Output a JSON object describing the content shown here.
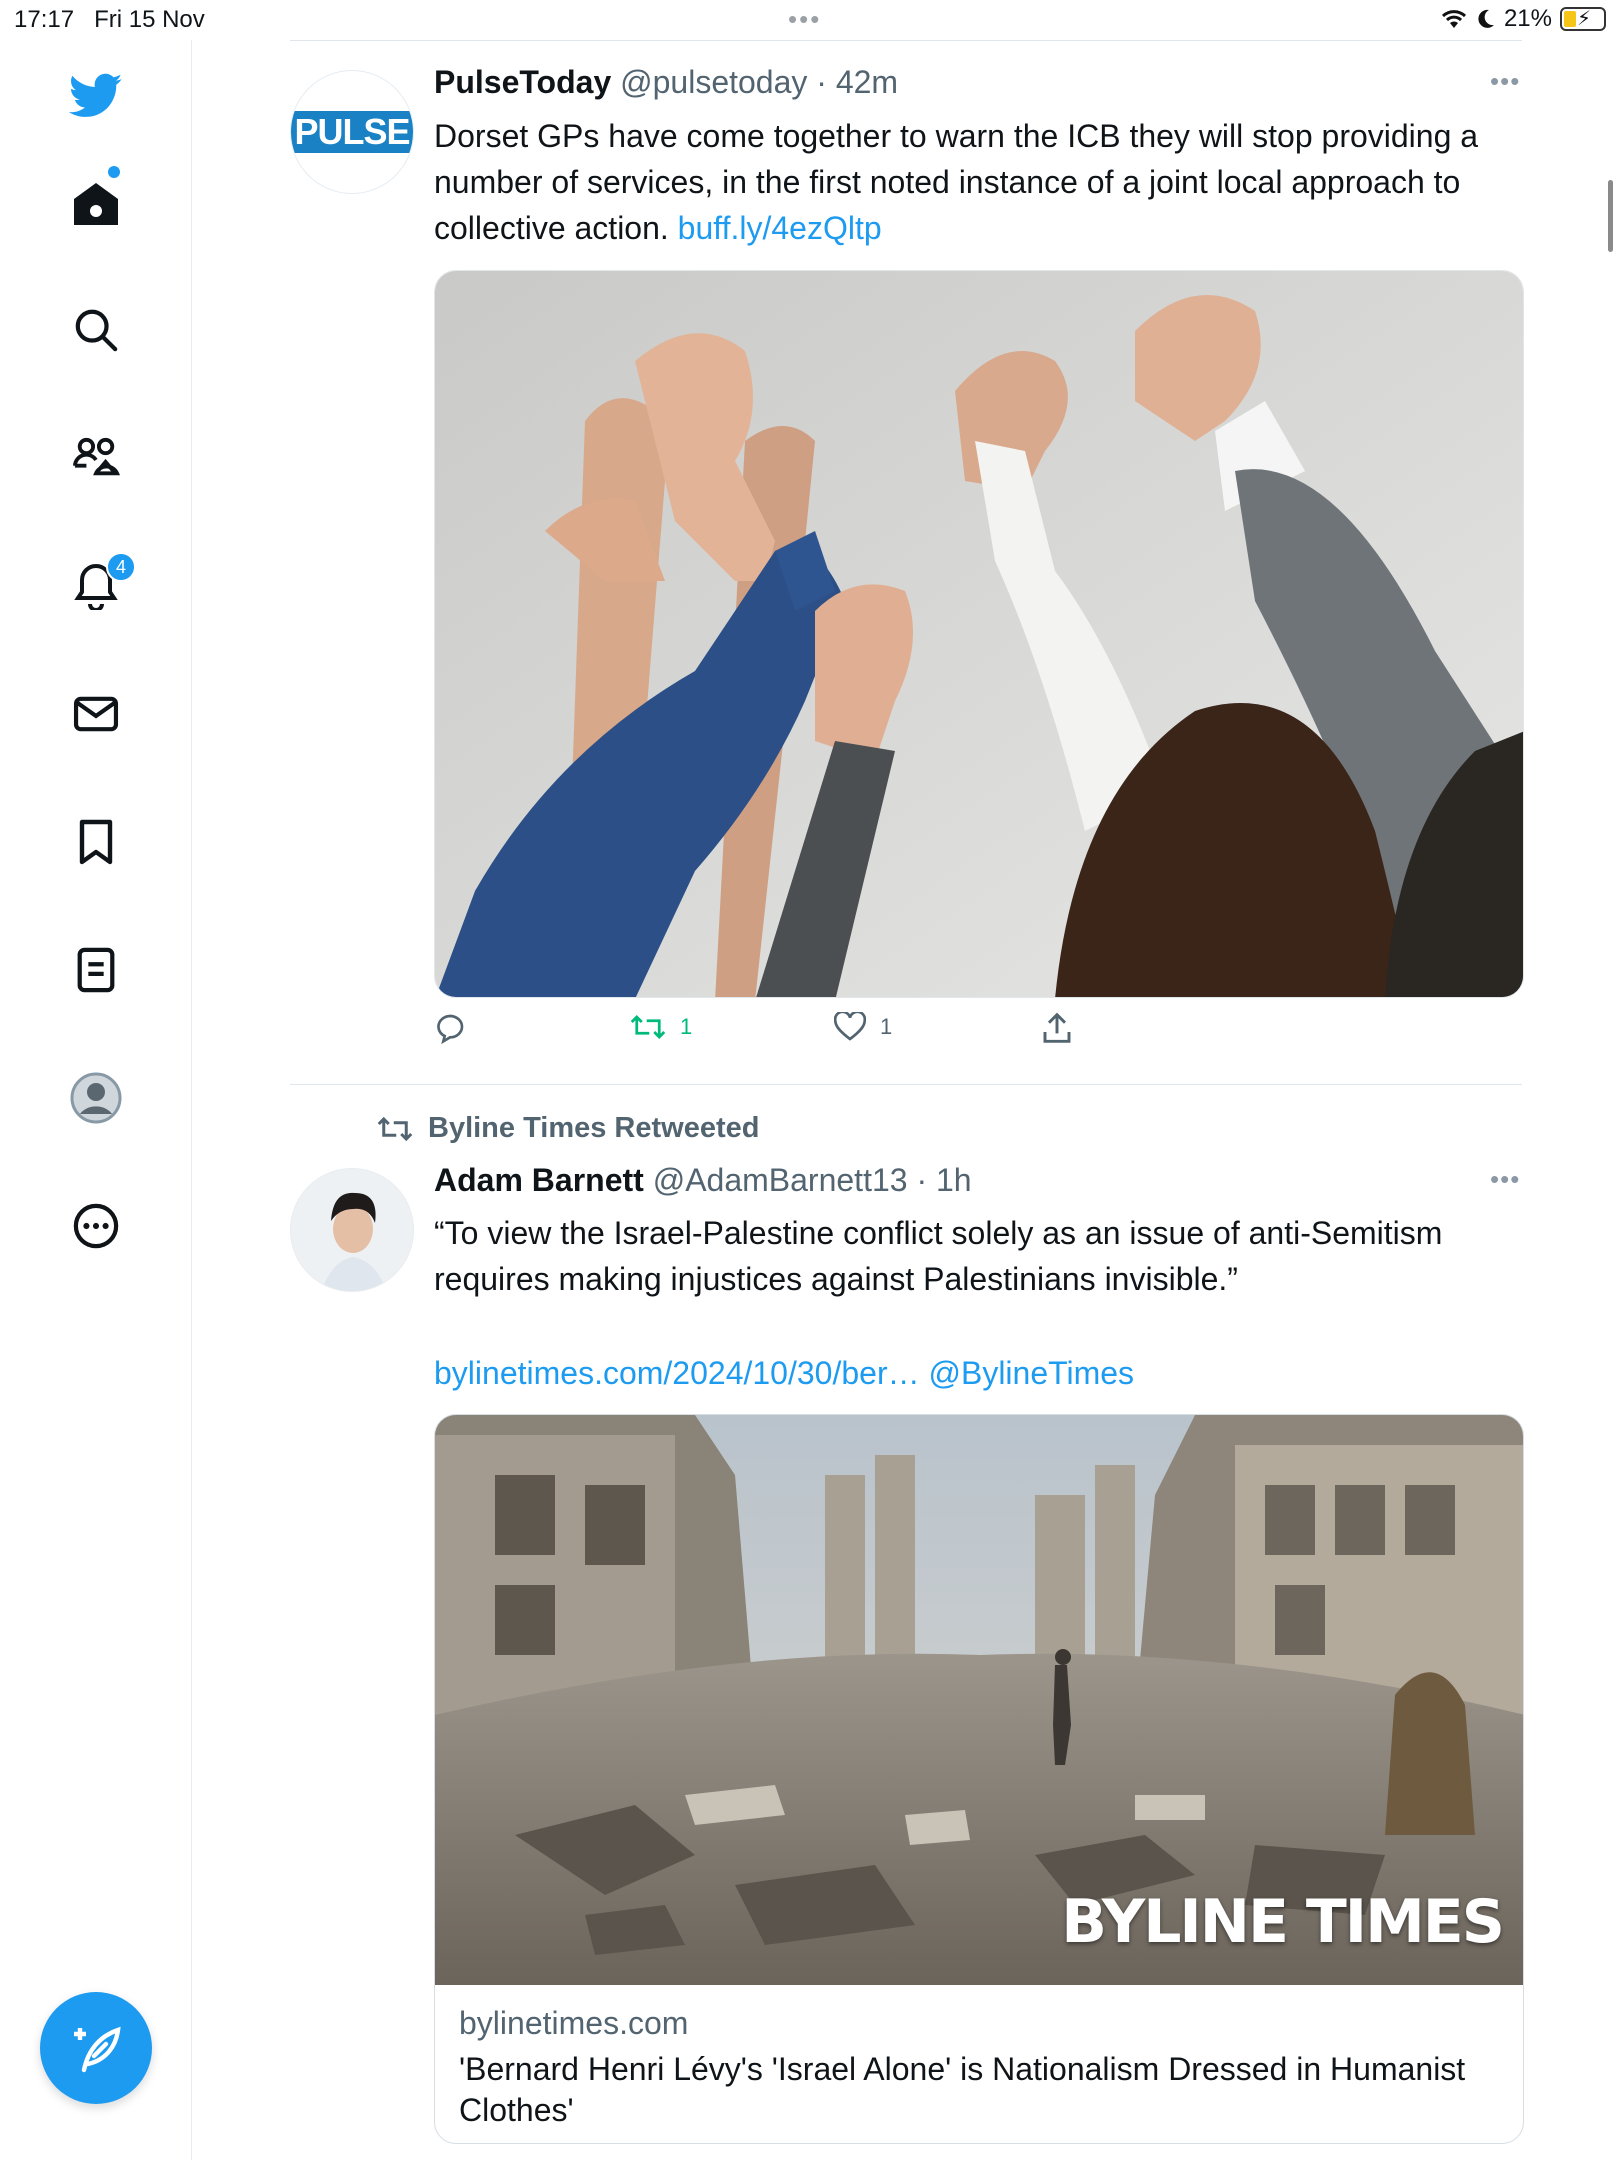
{
  "status_bar": {
    "time": "17:17",
    "date": "Fri 15 Nov",
    "battery": "21%",
    "dots": "•••"
  },
  "sidebar": {
    "items": [
      {
        "icon": "twitter-bird-icon"
      },
      {
        "icon": "home-icon"
      },
      {
        "icon": "search-icon"
      },
      {
        "icon": "communities-icon"
      },
      {
        "icon": "notifications-icon",
        "badge": "4"
      },
      {
        "icon": "messages-icon"
      },
      {
        "icon": "bookmarks-icon"
      },
      {
        "icon": "lists-icon"
      },
      {
        "icon": "profile-icon"
      },
      {
        "icon": "more-icon"
      }
    ],
    "compose_icon": "compose-feather-icon",
    "accent": "#1d9bf0"
  },
  "tweets": [
    {
      "name": "PulseToday",
      "handle": "@pulsetoday",
      "time": "42m",
      "avatar_text": "PULSE",
      "text": "Dorset GPs have come together to warn the ICB they will stop providing a number of services, in the first noted instance of a joint local approach to collective action.",
      "link": "buff.ly/4ezQltp",
      "image_alt": "Raised fists photo",
      "actions": {
        "reply": "",
        "retweet": "1",
        "like": "1",
        "share": ""
      },
      "more": "•••"
    },
    {
      "retweeted_by": "Byline Times Retweeted",
      "name": "Adam Barnett",
      "handle": "@AdamBarnett13",
      "time": "1h",
      "text": "“To view the Israel-Palestine conflict solely as an issue of anti-Semitism requires making injustices against Palestinians invisible.”",
      "link": "bylinetimes.com/2024/10/30/ber…",
      "mention": "@BylineTimes",
      "more": "•••",
      "card": {
        "watermark": "BYLINE TIMES",
        "domain": "bylinetimes.com",
        "title": "'Bernard Henri Lévy's 'Israel Alone' is Nationalism Dressed in Humanist Clothes'"
      }
    }
  ]
}
